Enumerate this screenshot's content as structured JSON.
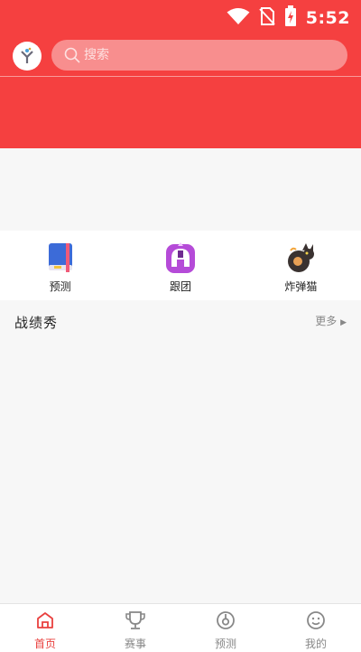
{
  "status_bar": {
    "time": "5:52",
    "icons": [
      "wifi-icon",
      "no-sim-icon",
      "battery-charging-icon"
    ]
  },
  "header": {
    "search_placeholder": "搜索",
    "logo": "app-logo-icon"
  },
  "shortcuts": [
    {
      "label": "预测",
      "icon": "book-icon"
    },
    {
      "label": "跟团",
      "icon": "spartan-helmet-icon"
    },
    {
      "label": "炸弹猫",
      "icon": "bomb-cat-icon"
    }
  ],
  "section": {
    "title": "战绩秀",
    "more": "更多"
  },
  "tabbar": [
    {
      "label": "首页",
      "icon": "home-icon",
      "active": true
    },
    {
      "label": "赛事",
      "icon": "trophy-icon",
      "active": false
    },
    {
      "label": "预测",
      "icon": "prediction-icon",
      "active": false
    },
    {
      "label": "我的",
      "icon": "profile-icon",
      "active": false
    }
  ],
  "colors": {
    "primary": "#f54040",
    "active_tab": "#e9403e",
    "inactive_tab": "#888888"
  }
}
